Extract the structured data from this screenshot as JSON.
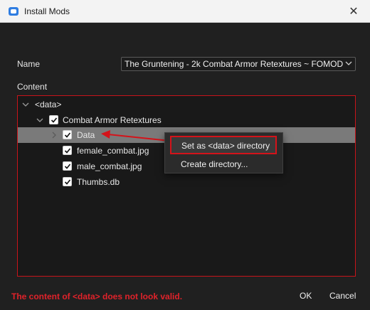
{
  "window": {
    "title": "Install Mods",
    "close_glyph": "✕"
  },
  "form": {
    "name_label": "Name",
    "name_value": "The Gruntening - 2k Combat Armor Retextures ~ FOMOD",
    "content_label": "Content"
  },
  "tree": {
    "root": "<data>",
    "folder": "Combat Armor Retextures",
    "items": [
      {
        "label": "Data",
        "checked": true,
        "selected": true
      },
      {
        "label": "female_combat.jpg",
        "checked": true
      },
      {
        "label": "male_combat.jpg",
        "checked": true
      },
      {
        "label": "Thumbs.db",
        "checked": true
      }
    ]
  },
  "context_menu": {
    "items": [
      "Set as <data> directory",
      "Create directory..."
    ]
  },
  "footer": {
    "error": "The content of <data> does not look valid.",
    "ok": "OK",
    "cancel": "Cancel"
  },
  "colors": {
    "accent_red": "#d4131a",
    "selection": "#7a7a7a",
    "background": "#202020"
  }
}
